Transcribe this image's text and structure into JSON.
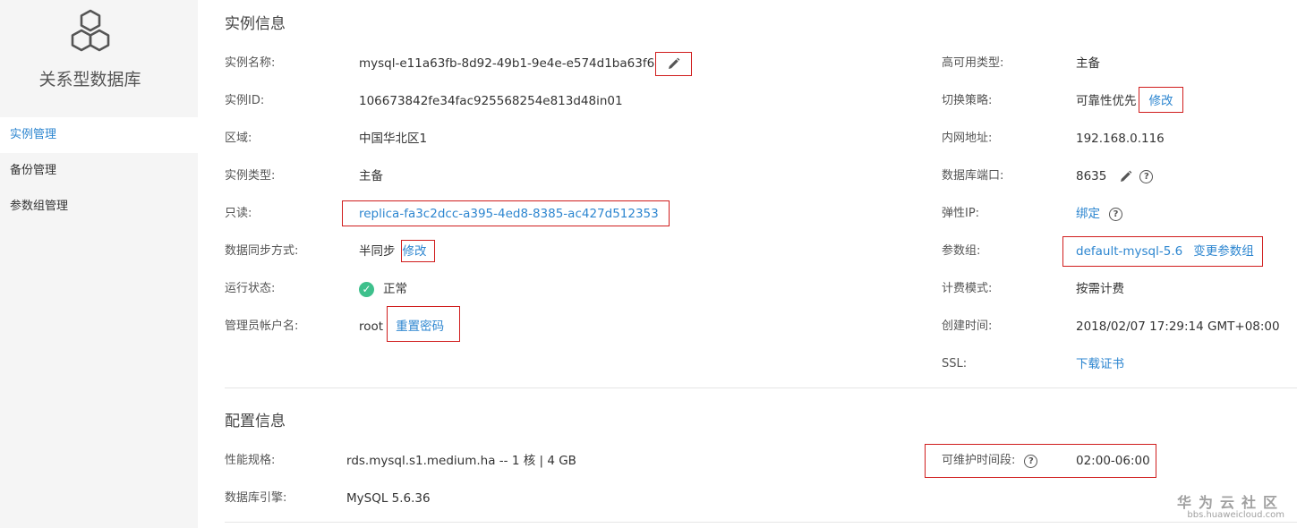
{
  "sidebar": {
    "title": "关系型数据库",
    "items": [
      {
        "label": "实例管理"
      },
      {
        "label": "备份管理"
      },
      {
        "label": "参数组管理"
      }
    ]
  },
  "instance_info": {
    "title": "实例信息",
    "left": {
      "name_label": "实例名称:",
      "name_value": "mysql-e11a63fb-8d92-49b1-9e4e-e574d1ba63f6",
      "id_label": "实例ID:",
      "id_value": "106673842fe34fac925568254e813d48in01",
      "region_label": "区域:",
      "region_value": "中国华北区1",
      "type_label": "实例类型:",
      "type_value": "主备",
      "readonly_label": "只读:",
      "readonly_value": "replica-fa3c2dcc-a395-4ed8-8385-ac427d512353",
      "sync_label": "数据同步方式:",
      "sync_value": "半同步",
      "sync_modify": "修改",
      "status_label": "运行状态:",
      "status_value": "正常",
      "admin_label": "管理员帐户名:",
      "admin_value": "root",
      "reset_password": "重置密码"
    },
    "right": {
      "ha_label": "高可用类型:",
      "ha_value": "主备",
      "switch_label": "切换策略:",
      "switch_value": "可靠性优先",
      "switch_modify": "修改",
      "intranet_label": "内网地址:",
      "intranet_value": "192.168.0.116",
      "port_label": "数据库端口:",
      "port_value": "8635",
      "eip_label": "弹性IP:",
      "eip_value": "绑定",
      "paramgroup_label": "参数组:",
      "paramgroup_value": "default-mysql-5.6",
      "paramgroup_change": "变更参数组",
      "billing_label": "计费模式:",
      "billing_value": "按需计费",
      "created_label": "创建时间:",
      "created_value": "2018/02/07 17:29:14 GMT+08:00",
      "ssl_label": "SSL:",
      "ssl_value": "下载证书"
    }
  },
  "config_info": {
    "title": "配置信息",
    "spec_label": "性能规格:",
    "spec_value": "rds.mysql.s1.medium.ha -- 1 核 | 4 GB",
    "engine_label": "数据库引擎:",
    "engine_value": "MySQL 5.6.36",
    "maint_label": "可维护时间段:",
    "maint_value": "02:00-06:00"
  },
  "watermark": {
    "line1": "华为云社区",
    "line2": "bbs.huaweicloud.com"
  },
  "colors": {
    "link": "#2d86d0",
    "highlight_box": "#d01d1d",
    "status_ok": "#3ec08c",
    "sidebar_bg": "#f5f5f5"
  }
}
